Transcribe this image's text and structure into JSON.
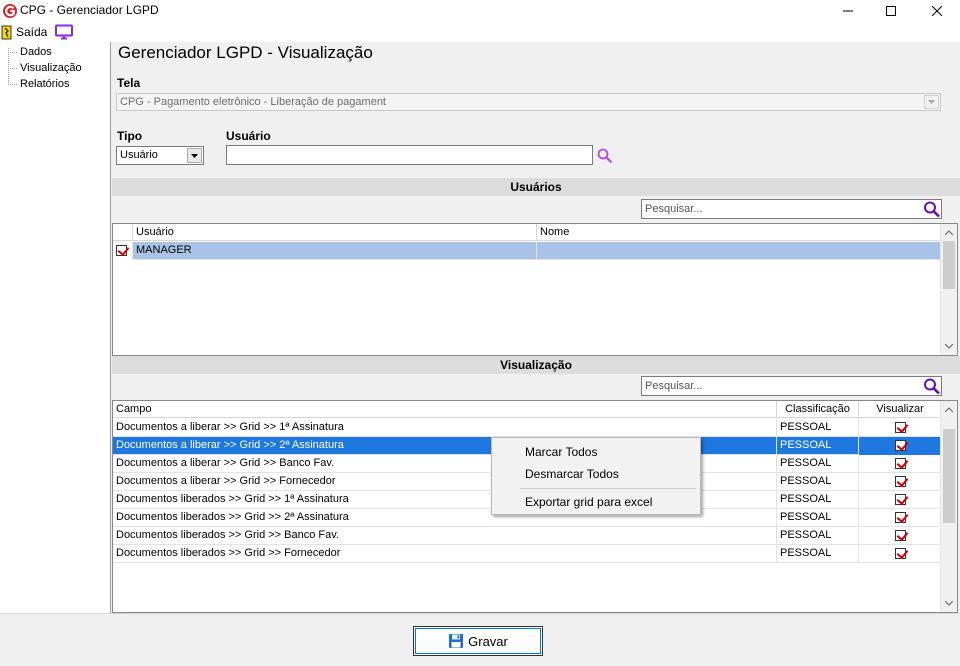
{
  "window": {
    "title": "CPG - Gerenciador LGPD"
  },
  "menu": {
    "exit_label": "Saída"
  },
  "tree": {
    "items": [
      {
        "label": "Dados"
      },
      {
        "label": "Visualização"
      },
      {
        "label": "Relatórios"
      }
    ]
  },
  "page": {
    "title": "Gerenciador LGPD - Visualização"
  },
  "form": {
    "tela_label": "Tela",
    "tela_value": "CPG - Pagamento eletrônico - Liberação de pagament",
    "tipo_label": "Tipo",
    "tipo_value": "Usuário",
    "usuario_label": "Usuário",
    "usuario_value": ""
  },
  "users_section": {
    "title": "Usuários",
    "search_placeholder": "Pesquisar...",
    "columns": [
      "Usuário",
      "Nome"
    ],
    "rows": [
      {
        "checked": true,
        "usuario": "MANAGER",
        "nome": ""
      }
    ]
  },
  "view_section": {
    "title": "Visualização",
    "search_placeholder": "Pesquisar...",
    "columns": [
      "Campo",
      "Classificação",
      "Visualizar"
    ],
    "rows": [
      {
        "campo": "Documentos a liberar >> Grid >> 1ª Assinatura",
        "classificacao": "PESSOAL",
        "visualizar": true
      },
      {
        "campo": "Documentos a liberar >> Grid >> 2ª Assinatura",
        "classificacao": "PESSOAL",
        "visualizar": true,
        "selected": true
      },
      {
        "campo": "Documentos a liberar >> Grid >> Banco Fav.",
        "classificacao": "PESSOAL",
        "visualizar": true
      },
      {
        "campo": "Documentos a liberar >> Grid >> Fornecedor",
        "classificacao": "PESSOAL",
        "visualizar": true
      },
      {
        "campo": "Documentos liberados >> Grid >> 1ª Assinatura",
        "classificacao": "PESSOAL",
        "visualizar": true
      },
      {
        "campo": "Documentos liberados >> Grid >> 2ª Assinatura",
        "classificacao": "PESSOAL",
        "visualizar": true
      },
      {
        "campo": "Documentos liberados >> Grid >> Banco Fav.",
        "classificacao": "PESSOAL",
        "visualizar": true
      },
      {
        "campo": "Documentos liberados >> Grid >> Fornecedor",
        "classificacao": "PESSOAL",
        "visualizar": true
      }
    ]
  },
  "context_menu": {
    "items": [
      "Marcar Todos",
      "Desmarcar Todos",
      "Exportar grid para excel"
    ]
  },
  "footer": {
    "save_label": "Gravar"
  },
  "colors": {
    "accent": "#1e78e0",
    "icon_purple": "#8a2be2",
    "check_red": "#d40000"
  }
}
